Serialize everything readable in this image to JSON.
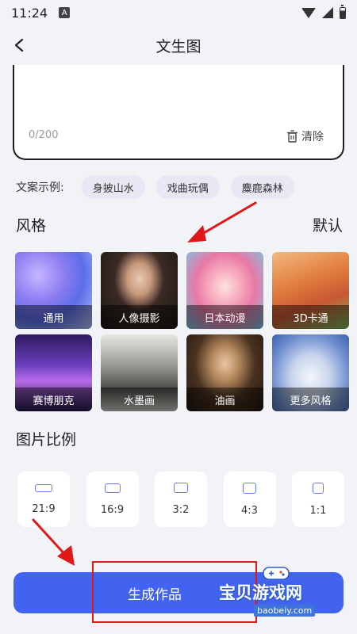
{
  "status_bar": {
    "time": "11:24",
    "a_badge": "A"
  },
  "nav": {
    "title": "文生图"
  },
  "prompt": {
    "counter": "0/200",
    "clear_label": "清除"
  },
  "examples": {
    "label": "文案示例:",
    "chips": [
      "身披山水",
      "戏曲玩偶",
      "麋鹿森林"
    ]
  },
  "style_section": {
    "title": "风格",
    "default_label": "默认"
  },
  "styles": [
    {
      "label": "通用",
      "selected": true
    },
    {
      "label": "人像摄影",
      "selected": false
    },
    {
      "label": "日本动漫",
      "selected": false
    },
    {
      "label": "3D卡通",
      "selected": false
    },
    {
      "label": "赛博朋克",
      "selected": false
    },
    {
      "label": "水墨画",
      "selected": false
    },
    {
      "label": "油画",
      "selected": false
    },
    {
      "label": "更多风格",
      "selected": false
    }
  ],
  "ratio_section": {
    "title": "图片比例"
  },
  "ratios": [
    "21:9",
    "16:9",
    "3:2",
    "4:3",
    "1:1"
  ],
  "generate_button": {
    "label": "生成作品"
  },
  "watermark": {
    "text": "宝贝游戏网",
    "url": "baobeiy.com"
  },
  "colors": {
    "accent": "#4263f0",
    "annotation": "#e01818",
    "chip_bg": "#e7e8f3"
  }
}
